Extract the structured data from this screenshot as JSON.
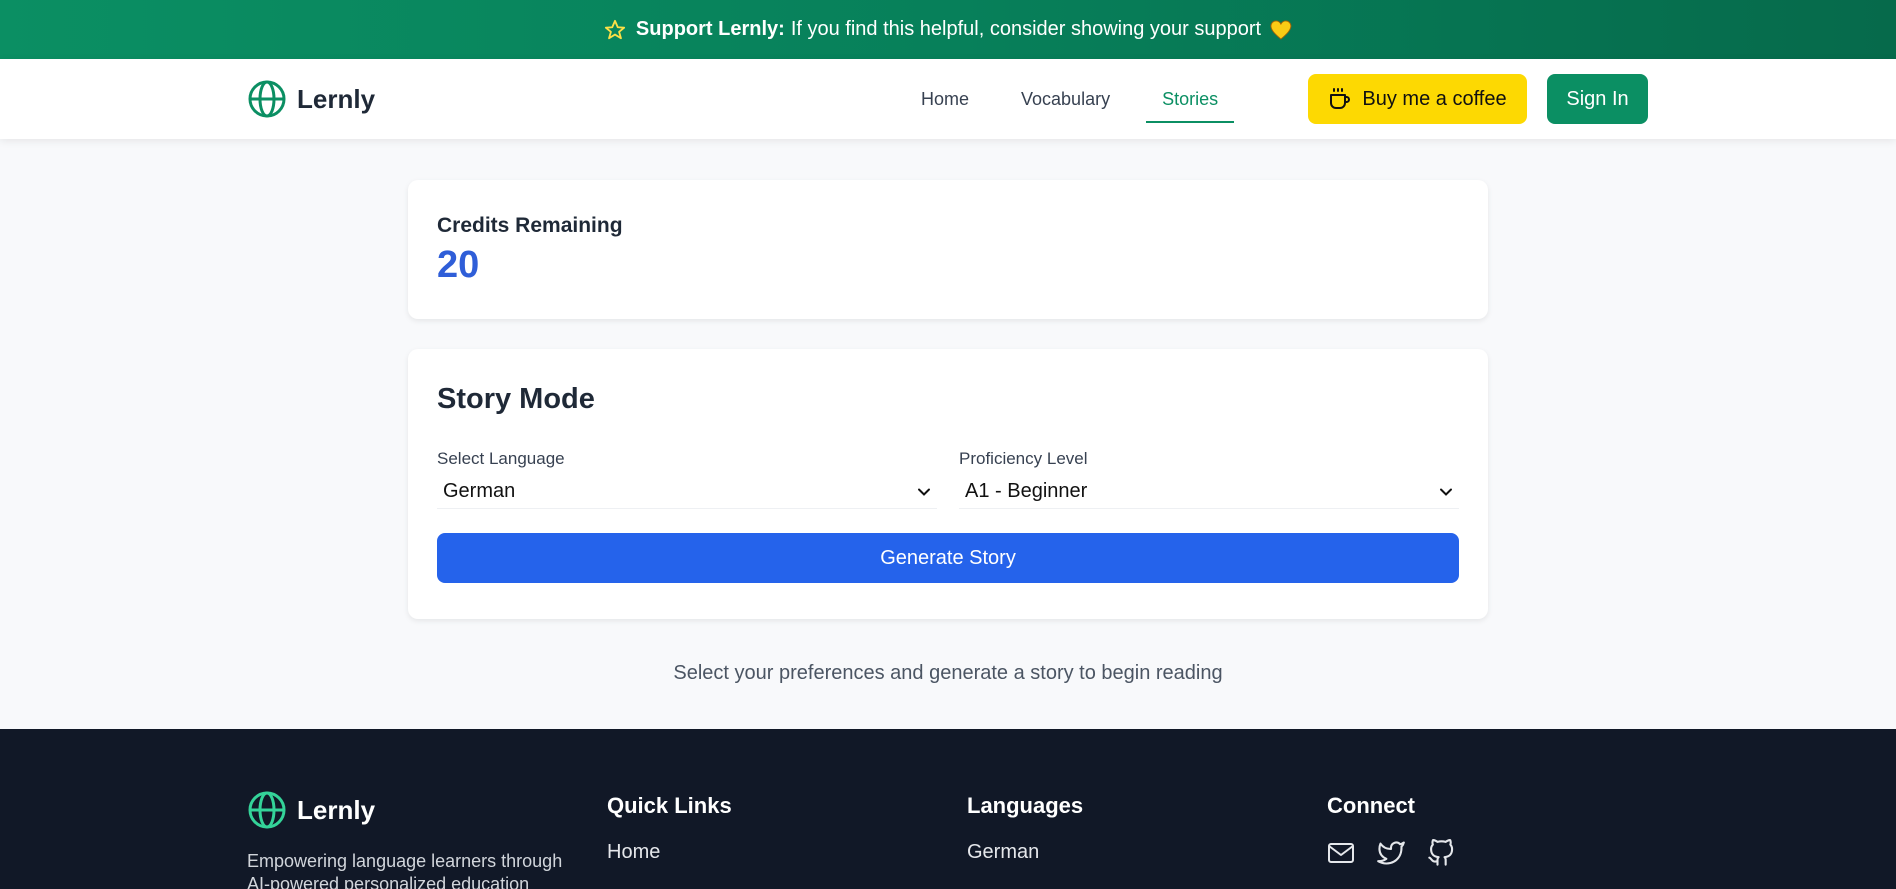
{
  "banner": {
    "bold": "Support Lernly:",
    "text": "If you find this helpful, consider showing your support",
    "icons": [
      "star-icon",
      "heart-icon"
    ]
  },
  "nav": {
    "brand": "Lernly",
    "links": [
      {
        "label": "Home",
        "active": false
      },
      {
        "label": "Vocabulary",
        "active": false
      },
      {
        "label": "Stories",
        "active": true
      }
    ],
    "coffee_label": "Buy me a coffee",
    "signin_label": "Sign In"
  },
  "credits": {
    "label": "Credits Remaining",
    "value": "20"
  },
  "story": {
    "title": "Story Mode",
    "language_label": "Select Language",
    "language_value": "German",
    "level_label": "Proficiency Level",
    "level_value": "A1 - Beginner",
    "generate_label": "Generate Story"
  },
  "hint": "Select your preferences and generate a story to begin reading",
  "footer": {
    "brand": "Lernly",
    "description": "Empowering language learners through AI-powered personalized education",
    "quick_links": {
      "title": "Quick Links",
      "items": [
        "Home"
      ]
    },
    "languages": {
      "title": "Languages",
      "items": [
        "German"
      ]
    },
    "connect": {
      "title": "Connect",
      "icons": [
        "mail-icon",
        "twitter-icon",
        "github-icon"
      ]
    }
  },
  "colors": {
    "brand_green": "#0b8f63",
    "accent_blue": "#2563eb",
    "coffee_yellow": "#fdd902",
    "footer_bg": "#111827"
  }
}
